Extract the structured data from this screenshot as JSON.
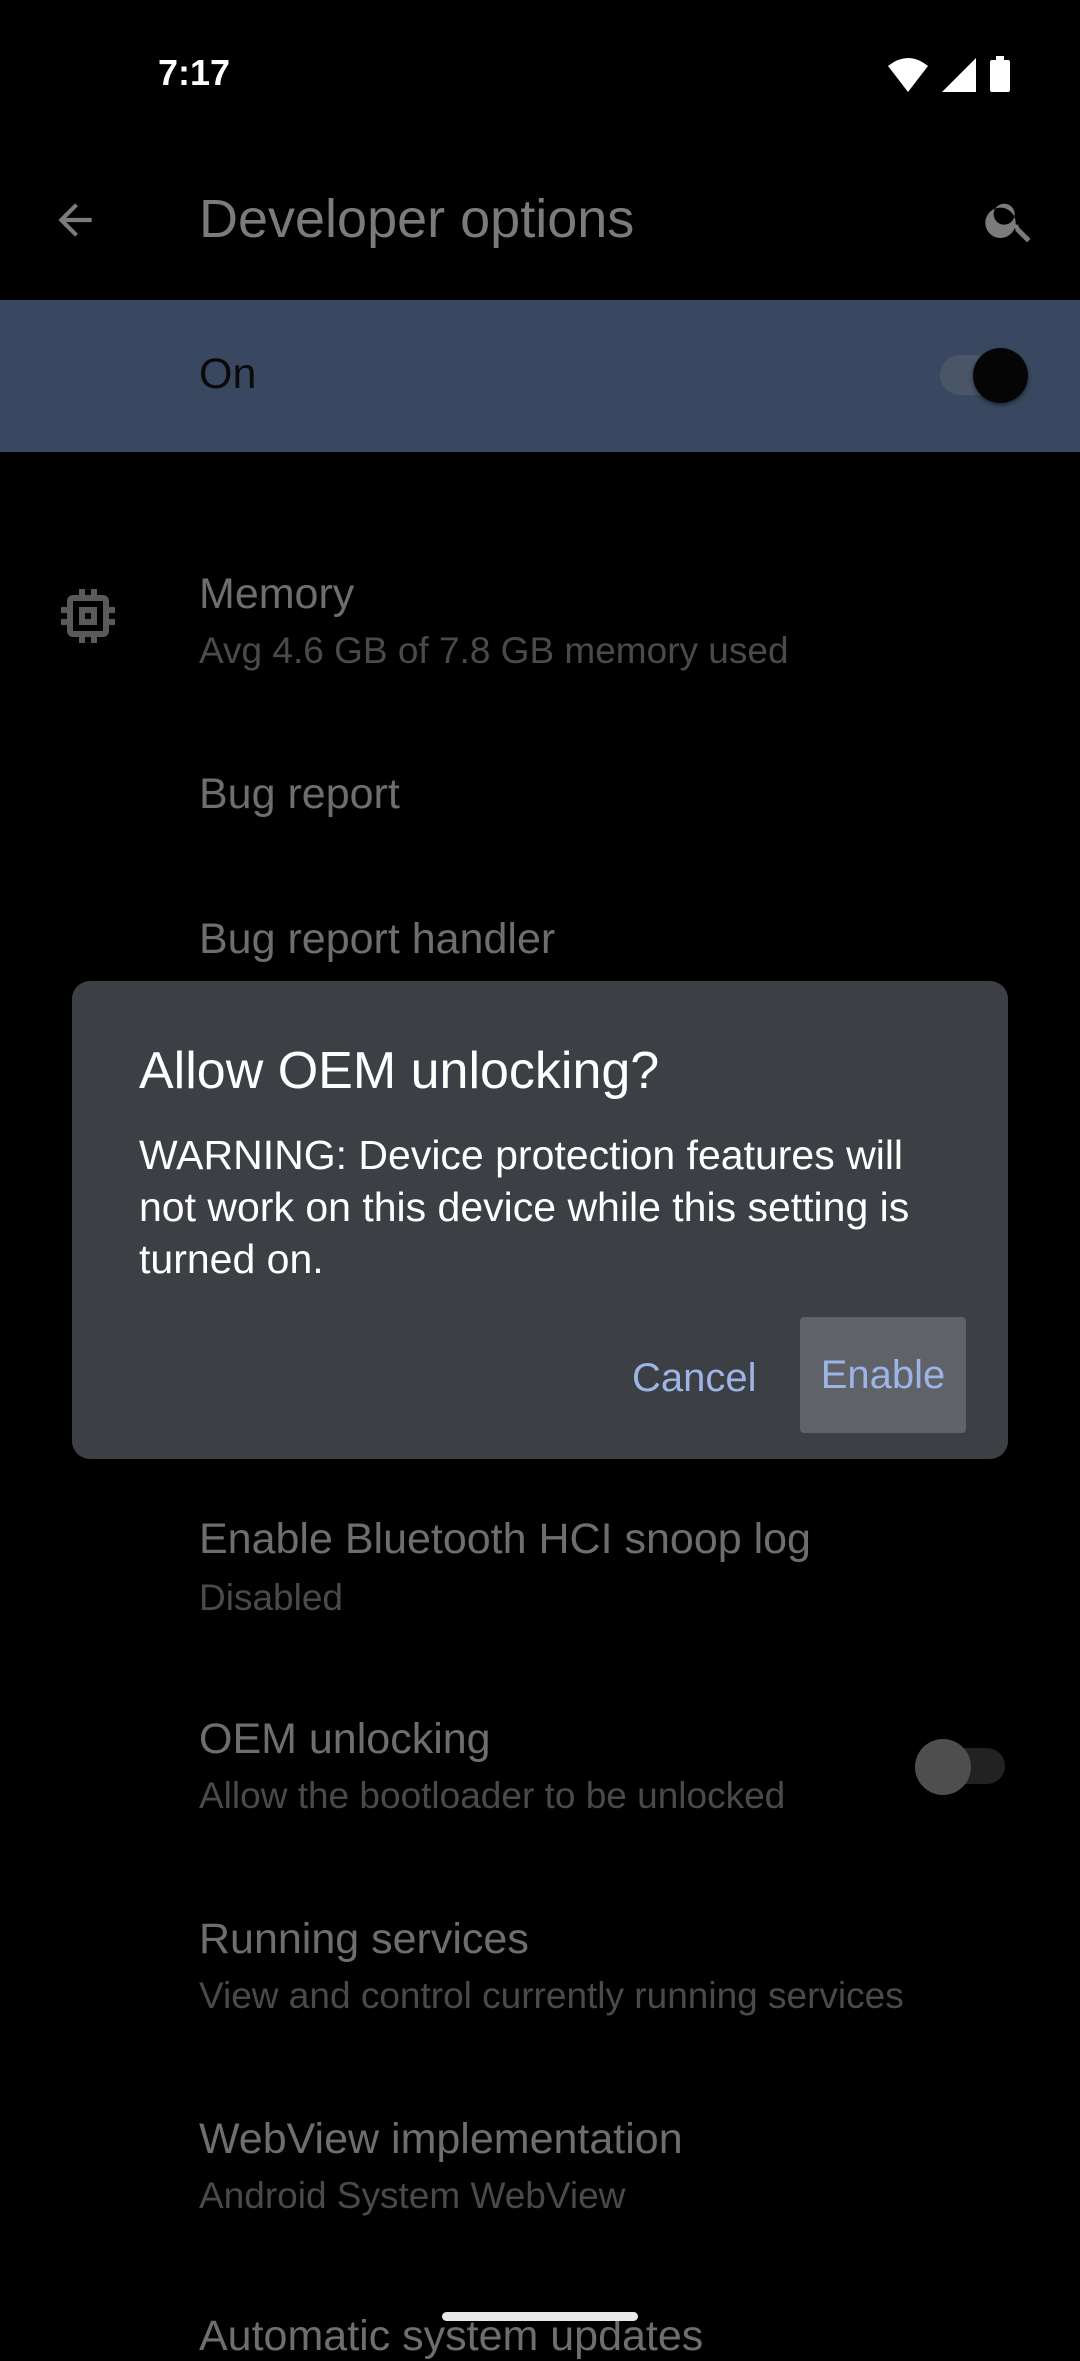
{
  "status_bar": {
    "time": "7:17",
    "icons": [
      "wifi-icon",
      "cellular-signal-icon",
      "battery-icon"
    ]
  },
  "app_bar": {
    "title": "Developer options",
    "back_icon": "arrow-back-icon",
    "search_icon": "search-icon"
  },
  "master_switch": {
    "label": "On",
    "state": true,
    "band_color": "#3a4760"
  },
  "settings": [
    {
      "title": "Memory",
      "subtitle": "Avg 4.6 GB of 7.8 GB memory used",
      "icon": "memory-chip-icon"
    },
    {
      "title": "Bug report",
      "subtitle": ""
    },
    {
      "title": "Bug report handler",
      "subtitle": ""
    },
    {
      "title": "Enable Bluetooth HCI snoop log",
      "subtitle": "Disabled"
    },
    {
      "title": "OEM unlocking",
      "subtitle": "Allow the bootloader to be unlocked",
      "toggle": false
    },
    {
      "title": "Running services",
      "subtitle": "View and control currently running services"
    },
    {
      "title": "WebView implementation",
      "subtitle": "Android System WebView"
    },
    {
      "title": "Automatic system updates",
      "subtitle": ""
    }
  ],
  "dialog": {
    "title": "Allow OEM unlocking?",
    "message": "WARNING: Device protection features will not work on this device while this setting is turned on.",
    "cancel_label": "Cancel",
    "confirm_label": "Enable",
    "accent_color": "#9db4e6",
    "background_color": "#3c3f43"
  }
}
